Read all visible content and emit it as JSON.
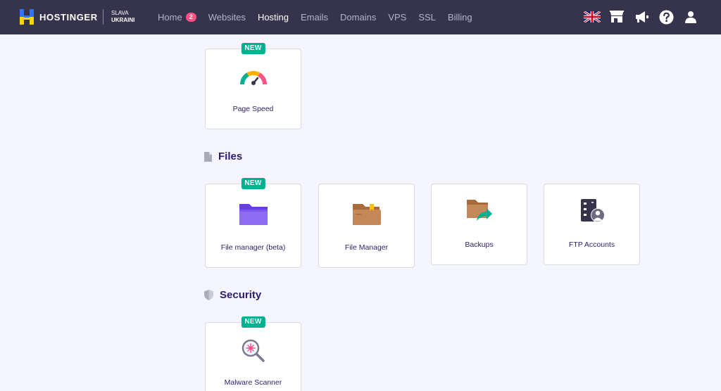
{
  "brand": {
    "name": "HOSTINGER",
    "slogan_line1": "SLAVA",
    "slogan_line2": "UKRAINI"
  },
  "nav": {
    "home": "Home",
    "home_badge": "2",
    "websites": "Websites",
    "hosting": "Hosting",
    "emails": "Emails",
    "domains": "Domains",
    "vps": "VPS",
    "ssl": "SSL",
    "billing": "Billing",
    "active": "Hosting"
  },
  "top_actions": [
    "uk-flag-icon",
    "store-icon",
    "megaphone-icon",
    "help-icon",
    "user-icon"
  ],
  "cards": {
    "page_speed": {
      "label": "Page Speed",
      "badge": "NEW"
    },
    "file_manager_beta": {
      "label": "File manager (beta)",
      "badge": "NEW"
    },
    "file_manager": {
      "label": "File Manager"
    },
    "backups": {
      "label": "Backups"
    },
    "ftp_accounts": {
      "label": "FTP Accounts"
    },
    "malware_scanner": {
      "label": "Malware Scanner",
      "badge": "NEW"
    }
  },
  "sections": {
    "files": "Files",
    "security": "Security"
  },
  "colors": {
    "topbar": "#36344d",
    "background": "#f4f5ff",
    "new_badge": "#00b090",
    "home_badge": "#fc5185",
    "text": "#2f1c6a"
  }
}
